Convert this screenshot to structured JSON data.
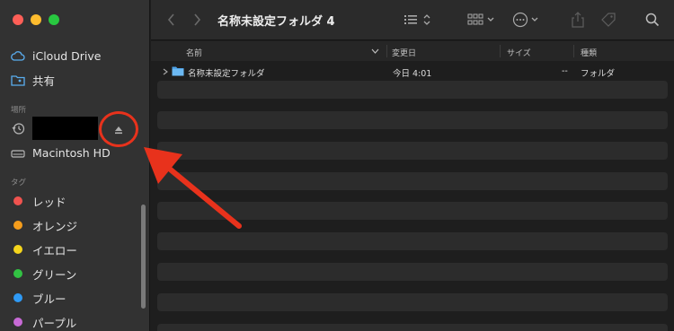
{
  "window": {
    "title": "名称未設定フォルダ 4"
  },
  "sidebar": {
    "favorites": [
      {
        "label": "iCloud Drive",
        "icon": "cloud-icon"
      },
      {
        "label": "共有",
        "icon": "shared-folder-icon"
      }
    ],
    "locations_label": "場所",
    "locations": [
      {
        "label": "",
        "icon": "recent-clock-icon",
        "redacted": true
      },
      {
        "label": "Macintosh HD",
        "icon": "drive-icon"
      }
    ],
    "tags_label": "タグ",
    "tags": [
      {
        "label": "レッド",
        "color": "#f0534f"
      },
      {
        "label": "オレンジ",
        "color": "#f59d1c"
      },
      {
        "label": "イエロー",
        "color": "#f5d51c"
      },
      {
        "label": "グリーン",
        "color": "#32c243"
      },
      {
        "label": "ブルー",
        "color": "#2f9af5"
      },
      {
        "label": "パープル",
        "color": "#c86ad6"
      }
    ]
  },
  "columns": {
    "name": "名前",
    "modified": "変更日",
    "size": "サイズ",
    "kind": "種類"
  },
  "files": [
    {
      "name": "名称未設定フォルダ",
      "modified": "今日 4:01",
      "size": "--",
      "kind": "フォルダ"
    }
  ],
  "colors": {
    "annotation": "#e8321c",
    "sidebar_bg": "#323232",
    "content_bg": "#1e1e1e"
  }
}
